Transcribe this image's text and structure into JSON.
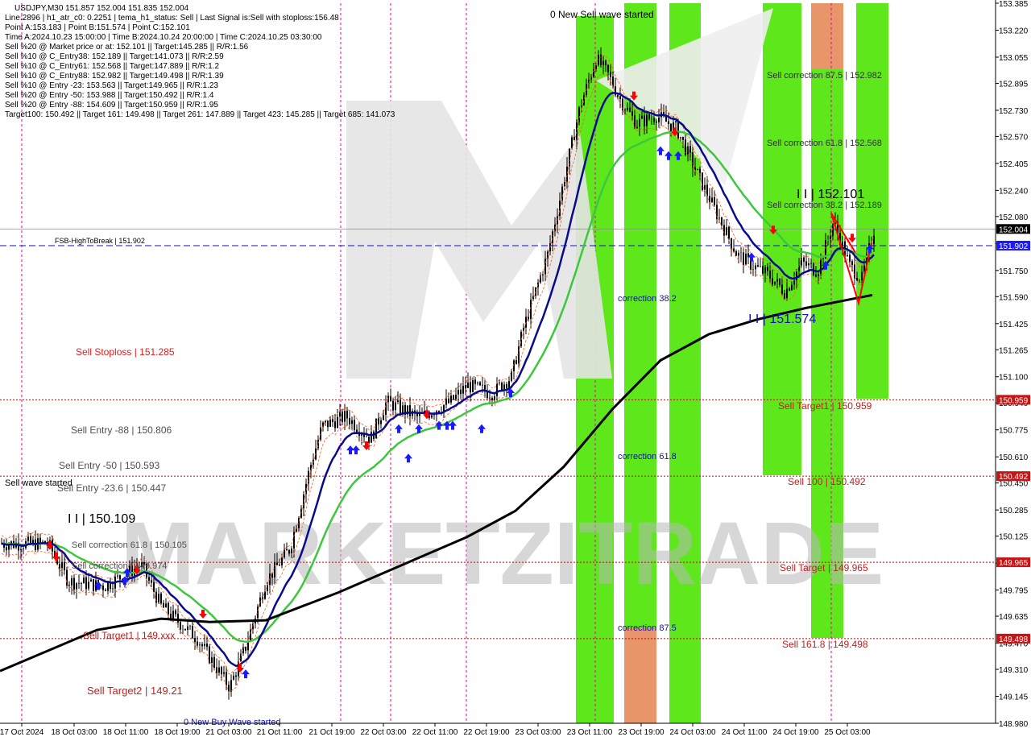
{
  "info_panel": [
    "USDJPY,M30  151.857 152.004 151.835 152.004",
    "Line:2896 | h1_atr_c0: 0.2251 | tema_h1_status: Sell | Last Signal is:Sell with stoploss:156.48",
    "Point A:153.183 | Point B:151.574 | Point C:152.101",
    "Time A:2024.10.23 15:00:00 | Time B:2024.10.24 20:00:00 | Time C:2024.10.25 03:30:00",
    "Sell %20 @ Market price or at: 152.101 || Target:145.285 || R/R:1.56",
    "Sell %10 @ C_Entry38: 152.189 || Target:141.073 || R/R:2.59",
    "Sell %10 @ C_Entry61: 152.568 || Target:147.889 || R/R:1.2",
    "Sell %10 @ C_Entry88: 152.982 || Target:149.498 || R/R:1.39",
    "Sell %10 @ Entry -23: 153.563 || Target:149.965 || R/R:1.23",
    "Sell %20 @ Entry -50: 153.988 || Target:150.492 || R/R:1.4",
    "Sell %20 @ Entry -88: 154.609 || Target:150.959 || R/R:1.95",
    "Target100: 150.492 || Target 161: 149.498 || Target 261: 147.889 || Target 423: 145.285 || Target 685: 141.073"
  ],
  "chart_data": {
    "type": "line",
    "symbol": "USDJPY,M30",
    "ylim": [
      148.98,
      153.385
    ],
    "y_ticks": [
      "153.385",
      "153.220",
      "153.055",
      "152.895",
      "152.730",
      "152.570",
      "152.405",
      "152.240",
      "152.080",
      "151.915",
      "151.750",
      "151.590",
      "151.425",
      "151.265",
      "151.100",
      "150.940",
      "150.775",
      "150.610",
      "150.450",
      "150.285",
      "150.125",
      "149.960",
      "149.795",
      "149.635",
      "149.470",
      "149.310",
      "149.145",
      "148.980"
    ],
    "x_ticks": [
      "17 Oct 2024",
      "18 Oct 03:00",
      "18 Oct 11:00",
      "18 Oct 19:00",
      "21 Oct 03:00",
      "21 Oct 11:00",
      "21 Oct 19:00",
      "22 Oct 03:00",
      "22 Oct 11:00",
      "22 Oct 19:00",
      "23 Oct 03:00",
      "23 Oct 11:00",
      "23 Oct 19:00",
      "24 Oct 03:00",
      "24 Oct 11:00",
      "24 Oct 19:00",
      "25 Oct 03:00"
    ],
    "price_marks": [
      {
        "value": 152.004,
        "label": "152.004",
        "style": "current"
      },
      {
        "value": 151.902,
        "label": "151.902",
        "style": "blue"
      },
      {
        "value": 150.959,
        "label": "150.959",
        "style": "red"
      },
      {
        "value": 150.492,
        "label": "150.492",
        "style": "red"
      },
      {
        "value": 149.965,
        "label": "149.965",
        "style": "red"
      },
      {
        "value": 149.498,
        "label": "149.498",
        "style": "red"
      }
    ],
    "level_lines": [
      {
        "value": 151.902,
        "color": "#1010c8",
        "dash": "8,4"
      },
      {
        "value": 150.959,
        "color": "#b01010",
        "dash": "2,2"
      },
      {
        "value": 150.492,
        "color": "#b01010",
        "dash": "2,2"
      },
      {
        "value": 149.965,
        "color": "#b01010",
        "dash": "2,2"
      },
      {
        "value": 149.498,
        "color": "#b01010",
        "dash": "2,2"
      }
    ],
    "annotations": [
      "0 New Sell wave started",
      "FSB-HighToBreak | 151.902",
      "Sell Stoploss | 151.285",
      "Sell Entry -88 | 150.806",
      "Sell Entry -50 | 150.593",
      "Sell Entry -23.6 | 150.447",
      "Sell wave started",
      "I I | 150.109",
      "Sell correction 61.8 | 150.105",
      "Sell correction | 149.974",
      "Sell Target1 | 149.xxx",
      "Sell Target2 | 149.21",
      "0 New Buy Wave started",
      "correction 38.2",
      "correction 61.8",
      "correction 87.5",
      "Sell correction 87.5 | 152.982",
      "Sell correction 61.8 | 152.568",
      "I I | 152.101",
      "Sell correction 38.2 | 152.189",
      "I I | 151.574",
      "Sell Target1 | 150.959",
      "Sell 100 | 150.492",
      "Sell Target | 149.965",
      "Sell 161.8 | 149.498"
    ],
    "watermark": "MARKETZITRADE",
    "colors": {
      "green_band": "#5ee81c",
      "orange_band": "#e8956a",
      "candle": "#000000",
      "tema_blue": "#0a0a8c",
      "ma_green": "#3cc83c",
      "ma_black": "#000000",
      "signal_red": "#ff0000",
      "signal_blue": "#1a1aff",
      "level_red": "#b01010"
    }
  }
}
